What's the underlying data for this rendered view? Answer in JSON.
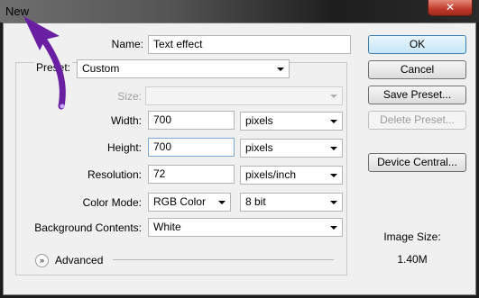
{
  "window": {
    "title": "New",
    "close_label": "✕"
  },
  "form": {
    "name_label": "Name:",
    "name_value": "Text effect",
    "preset_label": "Preset:",
    "preset_value": "Custom",
    "size_label": "Size:",
    "size_value": "",
    "width_label": "Width:",
    "width_value": "700",
    "width_unit": "pixels",
    "height_label": "Height:",
    "height_value": "700",
    "height_unit": "pixels",
    "resolution_label": "Resolution:",
    "resolution_value": "72",
    "resolution_unit": "pixels/inch",
    "color_mode_label": "Color Mode:",
    "color_mode_value": "RGB Color",
    "bit_depth_value": "8 bit",
    "background_label": "Background Contents:",
    "background_value": "White",
    "advanced_label": "Advanced"
  },
  "buttons": {
    "ok": "OK",
    "cancel": "Cancel",
    "save_preset": "Save Preset...",
    "delete_preset": "Delete Preset...",
    "device_central": "Device Central..."
  },
  "image_size": {
    "label": "Image Size:",
    "value": "1.40M"
  },
  "annotation": {
    "arrow_color": "#6a1fa3"
  }
}
